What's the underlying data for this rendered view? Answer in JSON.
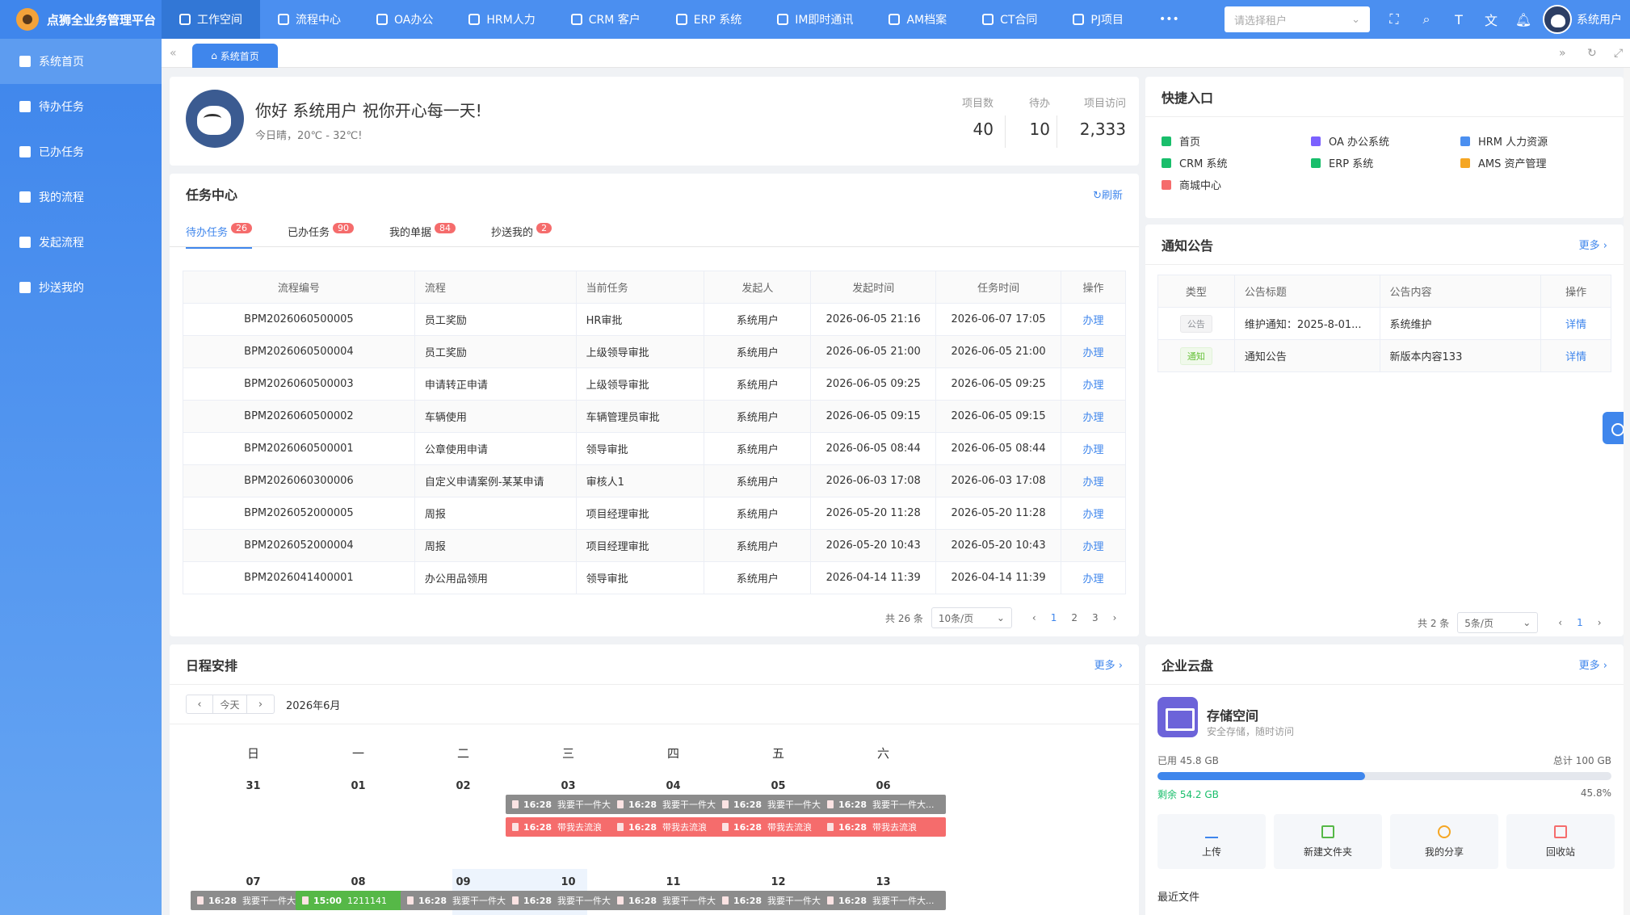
{
  "app_title": "点狮全业务管理平台",
  "top_nav": [
    {
      "label": "工作空间",
      "active": true
    },
    {
      "label": "流程中心"
    },
    {
      "label": "OA办公"
    },
    {
      "label": "HRM人力"
    },
    {
      "label": "CRM 客户"
    },
    {
      "label": "ERP 系统"
    },
    {
      "label": "IM即时通讯"
    },
    {
      "label": "AM档案"
    },
    {
      "label": "CT合同"
    },
    {
      "label": "PJ项目"
    }
  ],
  "tenant_placeholder": "请选择租户",
  "user_name": "系统用户",
  "sidebar": [
    {
      "label": "系统首页",
      "active": true
    },
    {
      "label": "待办任务"
    },
    {
      "label": "已办任务"
    },
    {
      "label": "我的流程"
    },
    {
      "label": "发起流程"
    },
    {
      "label": "抄送我的"
    }
  ],
  "page_tab": "系统首页",
  "welcome": {
    "greeting": "你好 系统用户 祝你开心每一天!",
    "weather": "今日晴，20℃ - 32℃!",
    "stats": [
      {
        "label": "项目数",
        "value": "40"
      },
      {
        "label": "待办",
        "value": "10"
      },
      {
        "label": "项目访问",
        "value": "2,333"
      }
    ]
  },
  "task_center": {
    "title": "任务中心",
    "refresh": "刷新",
    "tabs": [
      {
        "label": "待办任务",
        "count": "26",
        "active": true
      },
      {
        "label": "已办任务",
        "count": "90"
      },
      {
        "label": "我的单据",
        "count": "84"
      },
      {
        "label": "抄送我的",
        "count": "2"
      }
    ],
    "columns": [
      "流程编号",
      "流程",
      "当前任务",
      "发起人",
      "发起时间",
      "任务时间",
      "操作"
    ],
    "rows": [
      [
        "BPM2026060500005",
        "员工奖励",
        "HR审批",
        "系统用户",
        "2026-06-05 21:16",
        "2026-06-07 17:05",
        "办理"
      ],
      [
        "BPM2026060500004",
        "员工奖励",
        "上级领导审批",
        "系统用户",
        "2026-06-05 21:00",
        "2026-06-05 21:00",
        "办理"
      ],
      [
        "BPM2026060500003",
        "申请转正申请",
        "上级领导审批",
        "系统用户",
        "2026-06-05 09:25",
        "2026-06-05 09:25",
        "办理"
      ],
      [
        "BPM2026060500002",
        "车辆使用",
        "车辆管理员审批",
        "系统用户",
        "2026-06-05 09:15",
        "2026-06-05 09:15",
        "办理"
      ],
      [
        "BPM2026060500001",
        "公章使用申请",
        "领导审批",
        "系统用户",
        "2026-06-05 08:44",
        "2026-06-05 08:44",
        "办理"
      ],
      [
        "BPM2026060300006",
        "自定义申请案例-某某申请",
        "审核人1",
        "系统用户",
        "2026-06-03 17:08",
        "2026-06-03 17:08",
        "办理"
      ],
      [
        "BPM2026052000005",
        "周报",
        "项目经理审批",
        "系统用户",
        "2026-05-20 11:28",
        "2026-05-20 11:28",
        "办理"
      ],
      [
        "BPM2026052000004",
        "周报",
        "项目经理审批",
        "系统用户",
        "2026-05-20 10:43",
        "2026-05-20 10:43",
        "办理"
      ],
      [
        "BPM2026041400001",
        "办公用品领用",
        "领导审批",
        "系统用户",
        "2026-04-14 11:39",
        "2026-04-14 11:39",
        "办理"
      ]
    ],
    "total": "共 26 条",
    "page_size": "10条/页",
    "pages": [
      "1",
      "2",
      "3"
    ]
  },
  "schedule": {
    "title": "日程安排",
    "more": "更多",
    "today": "今天",
    "month": "2026年6月",
    "weekdays": [
      "日",
      "一",
      "二",
      "三",
      "四",
      "五",
      "六"
    ],
    "week1": [
      "31",
      "01",
      "02",
      "03",
      "04",
      "05",
      "06"
    ],
    "week2": [
      "07",
      "08",
      "09",
      "10",
      "11",
      "12",
      "13"
    ],
    "ev_time": "16:28",
    "ev_gray_text": "我要干一件大...",
    "ev_red_text": "带我去流浪",
    "ev_green_time": "15:00",
    "ev_green_text": "1211141"
  },
  "quick": {
    "title": "快捷入口",
    "items": [
      {
        "label": "首页",
        "color": "#19be6b"
      },
      {
        "label": "OA 办公系统",
        "color": "#7b61ff"
      },
      {
        "label": "HRM 人力资源",
        "color": "#4b8ff0"
      },
      {
        "label": "CRM 系统",
        "color": "#19be6b"
      },
      {
        "label": "ERP 系统",
        "color": "#19be6b"
      },
      {
        "label": "AMS 资产管理",
        "color": "#f5a623"
      },
      {
        "label": "商城中心",
        "color": "#f56c6c"
      }
    ]
  },
  "notice": {
    "title": "通知公告",
    "more": "更多",
    "columns": [
      "类型",
      "公告标题",
      "公告内容",
      "操作"
    ],
    "rows": [
      {
        "type": "公告",
        "title": "维护通知：2025-8-01...",
        "content": "系统维护",
        "action": "详情"
      },
      {
        "type": "通知",
        "title": "通知公告",
        "content": "新版本内容133",
        "action": "详情"
      }
    ],
    "total": "共 2 条",
    "page_size": "5条/页",
    "page": "1"
  },
  "cloud": {
    "title": "企业云盘",
    "more": "更多",
    "storage_title": "存储空间",
    "storage_sub": "安全存储，随时访问",
    "used": "已用 45.8 GB",
    "total": "总计 100 GB",
    "remain": "剩余 54.2 GB",
    "percent": "45.8%",
    "fill": 0.458,
    "buttons": [
      "上传",
      "新建文件夹",
      "我的分享",
      "回收站"
    ],
    "recent": "最近文件"
  }
}
